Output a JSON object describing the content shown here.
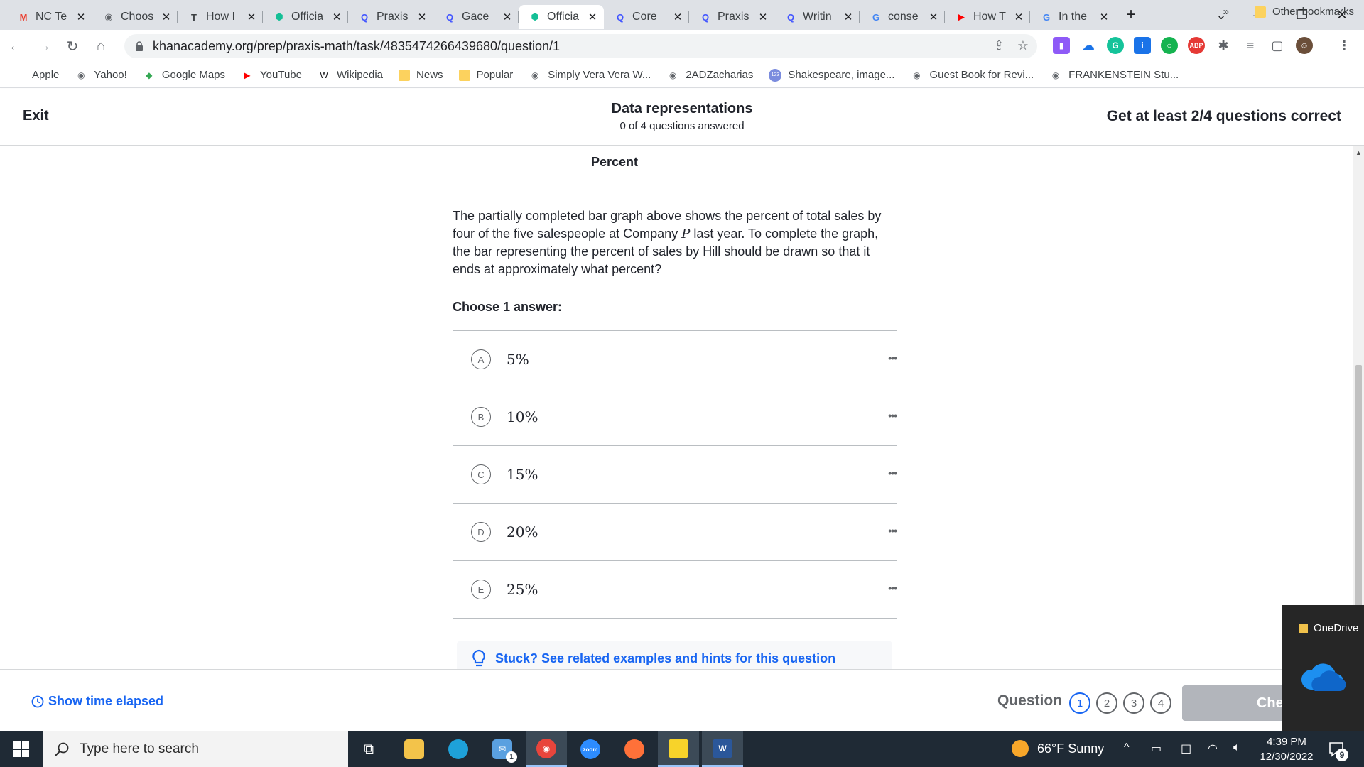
{
  "browser": {
    "tabs": [
      {
        "label": "NC Te",
        "favicon": "gmail-icon",
        "color": "#ea4335",
        "glyph": "M"
      },
      {
        "label": "Choos",
        "favicon": "globe-icon",
        "color": "#5f6368",
        "glyph": "◉"
      },
      {
        "label": "How I",
        "favicon": "t-icon",
        "color": "#3c4043",
        "glyph": "T"
      },
      {
        "label": "Officia",
        "favicon": "khan-academy-icon",
        "color": "#14bf96",
        "glyph": "⬢"
      },
      {
        "label": "Praxis",
        "favicon": "quizlet-icon",
        "color": "#4255ff",
        "glyph": "Q"
      },
      {
        "label": "Gace",
        "favicon": "quizlet-icon",
        "color": "#4255ff",
        "glyph": "Q"
      },
      {
        "label": "Officia",
        "favicon": "khan-academy-icon",
        "color": "#14bf96",
        "glyph": "⬢",
        "active": true
      },
      {
        "label": "Core",
        "favicon": "quizlet-icon",
        "color": "#4255ff",
        "glyph": "Q"
      },
      {
        "label": "Praxis",
        "favicon": "quizlet-icon",
        "color": "#4255ff",
        "glyph": "Q"
      },
      {
        "label": "Writin",
        "favicon": "quizlet-icon",
        "color": "#4255ff",
        "glyph": "Q"
      },
      {
        "label": "conse",
        "favicon": "google-icon",
        "color": "#4285f4",
        "glyph": "G"
      },
      {
        "label": "How T",
        "favicon": "youtube-icon",
        "color": "#ff0000",
        "glyph": "▶"
      },
      {
        "label": "In the",
        "favicon": "google-icon",
        "color": "#4285f4",
        "glyph": "G"
      }
    ],
    "new_tab": "+",
    "url": "khanacademy.org/prep/praxis-math/task/4835474266439680/question/1",
    "bookmarks": [
      {
        "label": "Apple",
        "icon": "apple-icon",
        "glyph": "",
        "color": "#555555"
      },
      {
        "label": "Yahoo!",
        "icon": "globe-icon",
        "glyph": "◉",
        "color": "#5f6368"
      },
      {
        "label": "Google Maps",
        "icon": "google-maps-icon",
        "glyph": "◆",
        "color": "#34a853"
      },
      {
        "label": "YouTube",
        "icon": "youtube-icon",
        "glyph": "▶",
        "color": "#ff0000"
      },
      {
        "label": "Wikipedia",
        "icon": "wikipedia-icon",
        "glyph": "W",
        "color": "#202124"
      },
      {
        "label": "News",
        "icon": "folder-icon",
        "folder": true
      },
      {
        "label": "Popular",
        "icon": "folder-icon",
        "folder": true
      },
      {
        "label": "Simply Vera Vera W...",
        "icon": "globe-icon",
        "glyph": "◉",
        "color": "#5f6368"
      },
      {
        "label": "2ADZacharias",
        "icon": "globe-icon",
        "glyph": "◉",
        "color": "#5f6368"
      },
      {
        "label": "Shakespeare, image...",
        "icon": "site-icon",
        "glyph": "123",
        "color": "#7b8cde"
      },
      {
        "label": "Guest Book for Revi...",
        "icon": "globe-icon",
        "glyph": "◉",
        "color": "#5f6368"
      },
      {
        "label": "FRANKENSTEIN Stu...",
        "icon": "globe-icon",
        "glyph": "◉",
        "color": "#5f6368"
      }
    ],
    "bookmarks_more": "»",
    "other_bookmarks": "Other bookmarks"
  },
  "header": {
    "exit": "Exit",
    "title": "Data representations",
    "subtitle": "0 of 4 questions answered",
    "goal": "Get at least 2/4 questions correct"
  },
  "question": {
    "chart_caption": "Percent",
    "text_before": "The partially completed bar graph above shows the percent of total sales by four of the five salespeople at Company ",
    "variable": "P",
    "text_after": " last year. To complete the graph, the bar representing the percent of sales by Hill should be drawn so that it ends at approximately what percent?",
    "choose_label": "Choose 1 answer:",
    "choices": [
      {
        "letter": "A",
        "text": "5%"
      },
      {
        "letter": "B",
        "text": "10%"
      },
      {
        "letter": "C",
        "text": "15%"
      },
      {
        "letter": "D",
        "text": "20%"
      },
      {
        "letter": "E",
        "text": "25%"
      }
    ],
    "hint_link": "Stuck? See related examples and hints for this question"
  },
  "footer": {
    "time_elapsed": "Show time elapsed",
    "question_label": "Question",
    "question_numbers": [
      "1",
      "2",
      "3",
      "4"
    ],
    "check": "Check"
  },
  "onedrive": {
    "label": "OneDrive"
  },
  "taskbar": {
    "search_placeholder": "Type here to search",
    "weather": "66°F  Sunny",
    "time": "4:39 PM",
    "date": "12/30/2022",
    "notification_count": "9",
    "mail_badge": "1"
  },
  "colors": {
    "accent_blue": "#1865f2",
    "ka_green": "#14bf96",
    "taskbar": "#1f2a35"
  }
}
